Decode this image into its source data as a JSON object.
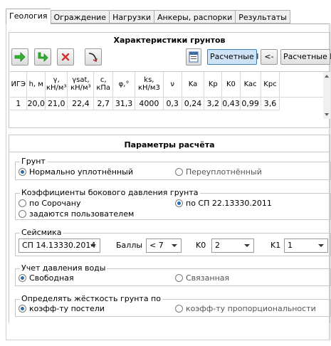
{
  "tabs": [
    {
      "label": "Геология",
      "active": true
    },
    {
      "label": "Ограждение",
      "active": false
    },
    {
      "label": "Нагрузки",
      "active": false
    },
    {
      "label": "Анкеры, распорки",
      "active": false
    },
    {
      "label": "Результаты",
      "active": false
    }
  ],
  "soil": {
    "title": "Характеристики грунтов",
    "toolbar": {
      "add_icon": "arrow-right-icon",
      "insert_icon": "arrow-down-right-icon",
      "delete_icon": "delete-x-icon",
      "edit_icon": "curve-arrow-icon",
      "sheet_icon": "sheet-icon",
      "calc1_label": "Расчетные I",
      "back_label": "<-",
      "calc2_label": "Расчетные II"
    },
    "columns": [
      "ИГЭ",
      "h, м",
      "γ,\nкН/м³",
      "γsat,\nкН/м³",
      "c,\nкПа",
      "φ,°",
      "ks,\nкН/м3",
      "ν",
      "Ka",
      "Kp",
      "K0",
      "Kac",
      "Kpc"
    ],
    "rows": [
      [
        "1",
        "20,0",
        "21,0",
        "22,4",
        "2,7",
        "31,3",
        "4000",
        "0,3",
        "0,24",
        "3,2",
        "0,43",
        "0,99",
        "3,6"
      ]
    ]
  },
  "params": {
    "title": "Параметры расчёта",
    "soil_group": {
      "legend": "Грунт",
      "opt1": "Нормально уплотнённый",
      "opt2": "Переуплотнённый",
      "selected": "opt1"
    },
    "lateral_group": {
      "legend": "Коэффициенты бокового давления грунта",
      "opt1": "по Сорочану",
      "opt2": "по СП 22.13330.2011",
      "opt3": "задаются пользователем",
      "selected": "opt2"
    },
    "seismic_group": {
      "legend": "Сейсмика",
      "norm_value": "СП 14.13330.2014",
      "points_label": "Баллы",
      "points_value": "< 7",
      "k0_label": "K0",
      "k0_value": "2",
      "k1_label": "K1",
      "k1_value": "1"
    },
    "water_group": {
      "legend": "Учет давления воды",
      "opt1": "Свободная",
      "opt2": "Связанная",
      "selected": "opt1"
    },
    "stiffness_group": {
      "legend": "Определять жёсткость грунта по",
      "opt1": "коэфф-ту постели",
      "opt2": "коэфф-ту пропорциональности",
      "selected": "opt1"
    }
  },
  "colors": {
    "accent": "#1f6fb9",
    "green_arrow": "#2fb52f",
    "red_x": "#d03030"
  }
}
